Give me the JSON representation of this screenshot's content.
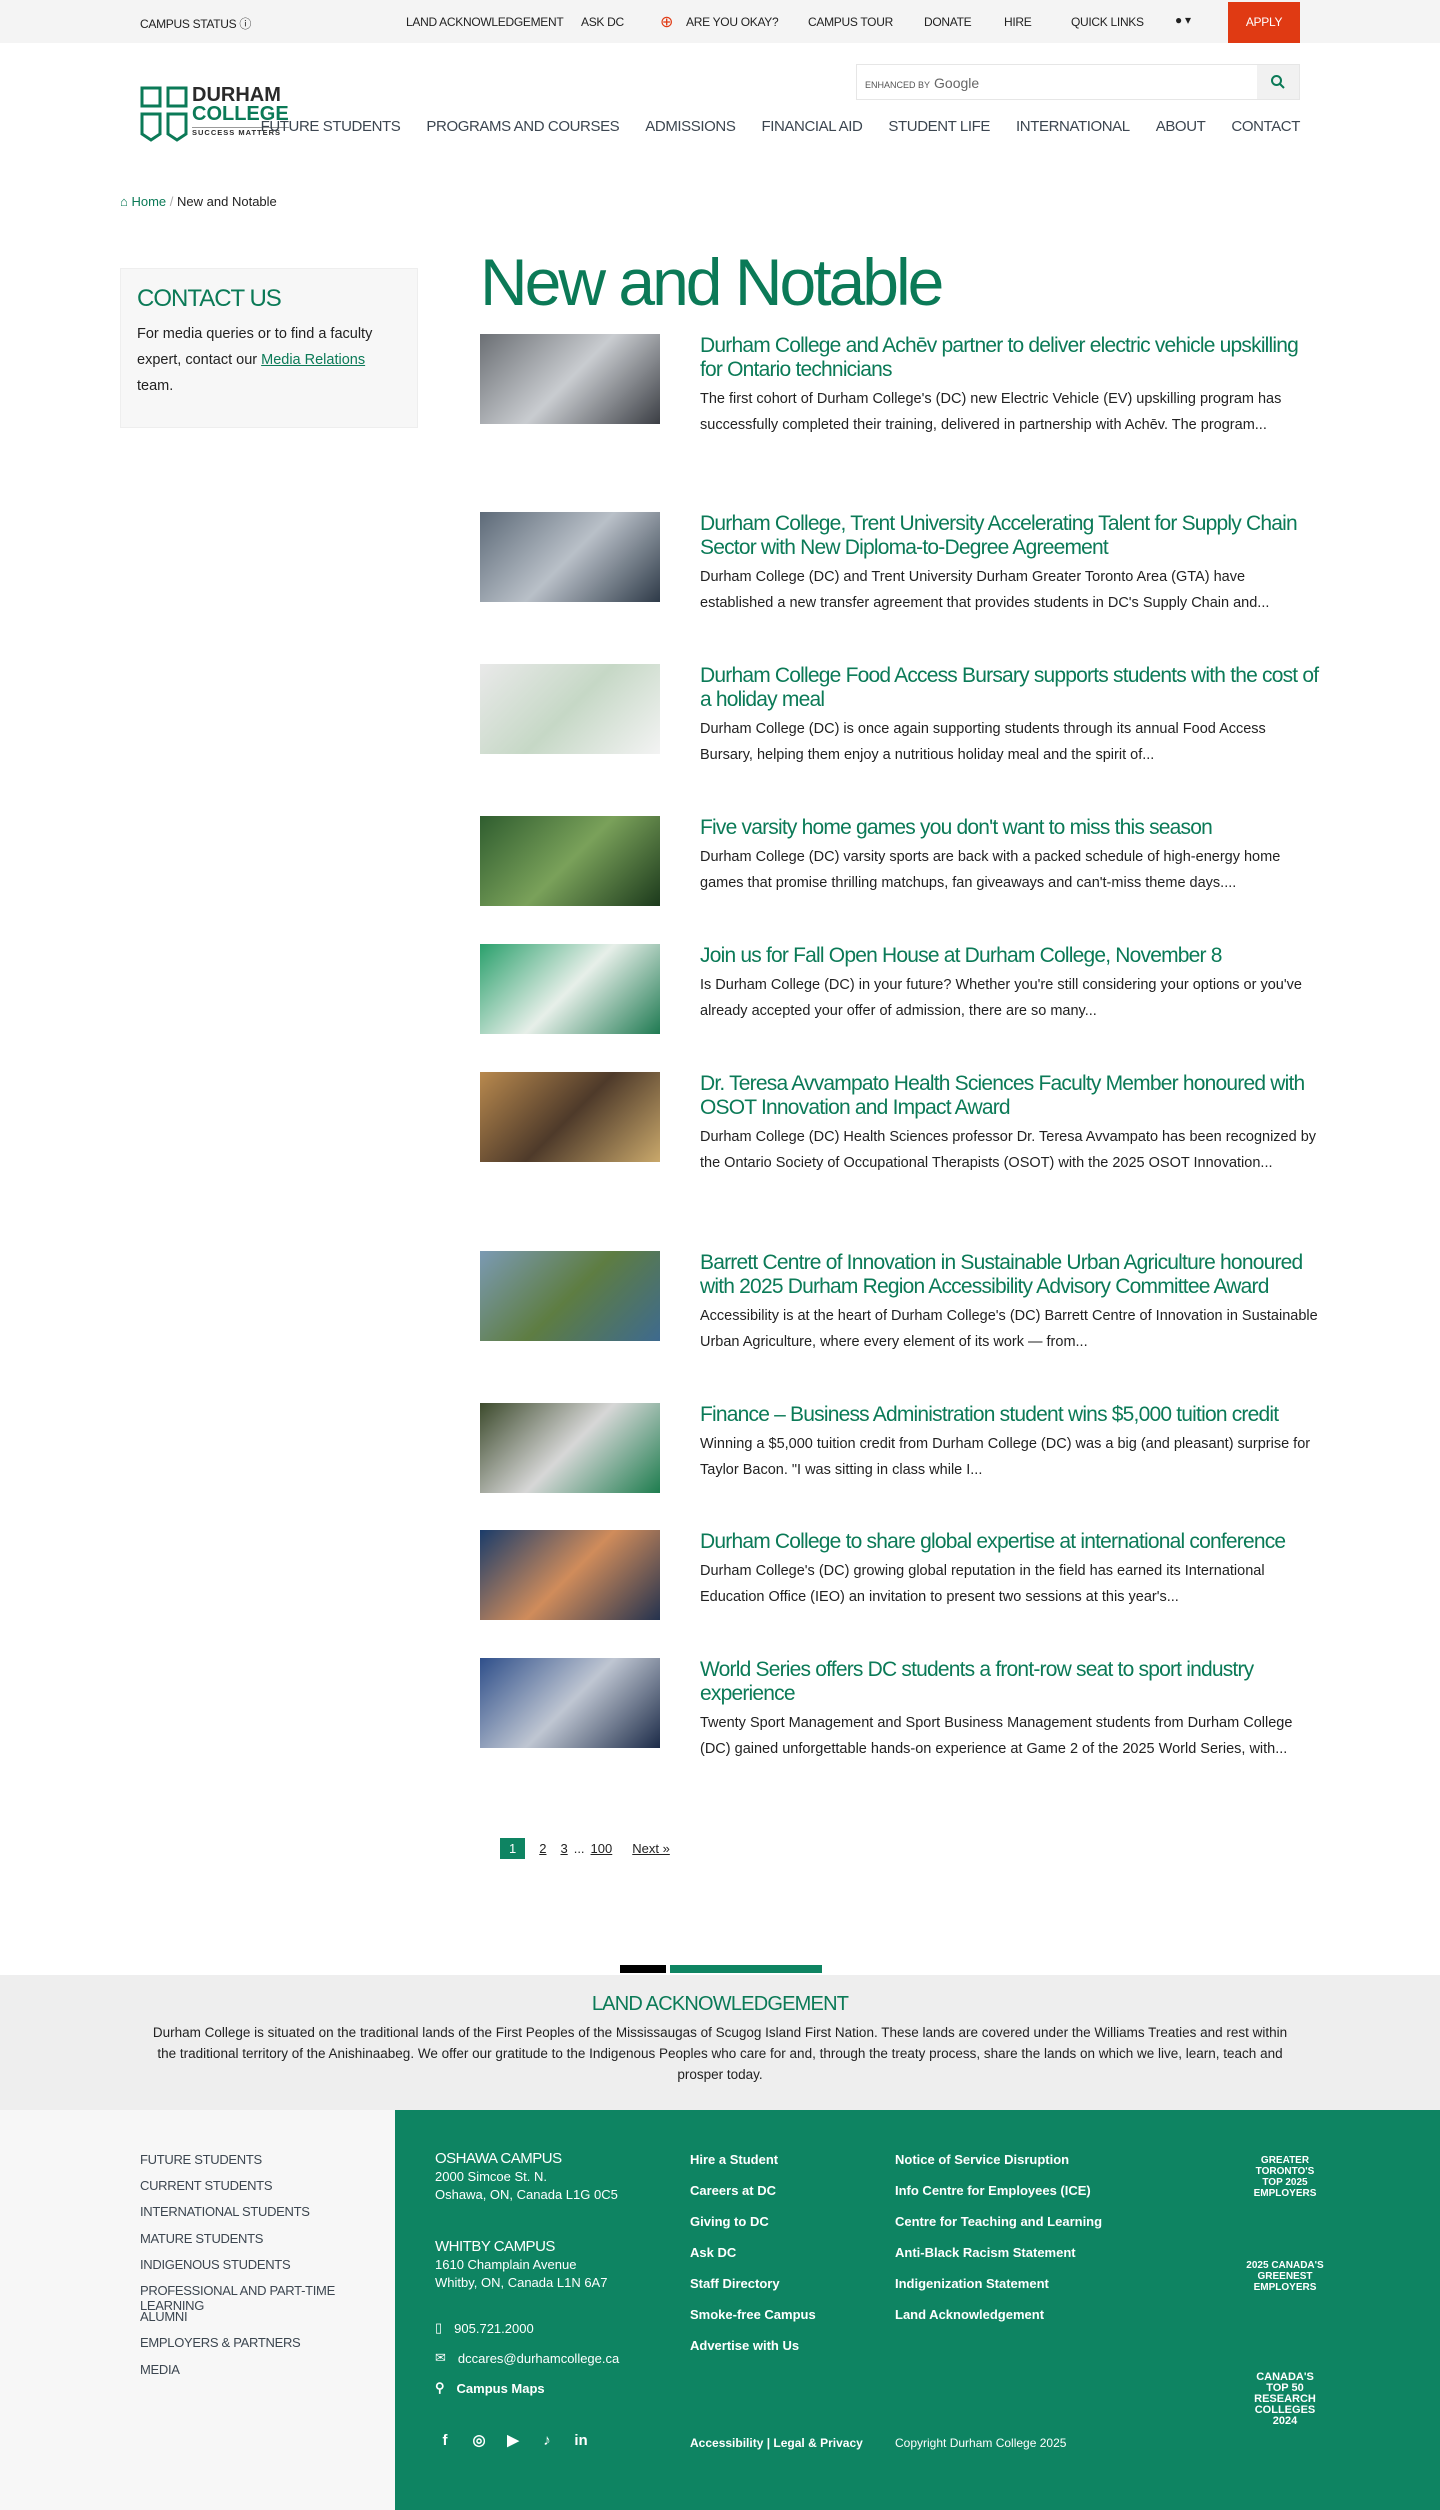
{
  "topbar": {
    "campus_status": "CAMPUS STATUS",
    "items": [
      "LAND ACKNOWLEDGEMENT",
      "ASK DC",
      "ARE YOU OKAY?",
      "CAMPUS TOUR",
      "DONATE",
      "HIRE",
      "QUICK LINKS"
    ],
    "apply": "APPLY"
  },
  "logo": {
    "line1": "DURHAM",
    "line2": "COLLEGE",
    "tagline": "SUCCESS MATTERS"
  },
  "search": {
    "enhanced": "ENHANCED BY",
    "google": "Google"
  },
  "nav": [
    "FUTURE STUDENTS",
    "PROGRAMS AND COURSES",
    "ADMISSIONS",
    "FINANCIAL AID",
    "STUDENT LIFE",
    "INTERNATIONAL",
    "ABOUT",
    "CONTACT"
  ],
  "breadcrumb": {
    "home": "Home",
    "current": "New and Notable"
  },
  "sidebar": {
    "title": "CONTACT US",
    "text_before": "For media queries or to find a faculty expert, contact our ",
    "link": "Media Relations",
    "text_after": " team."
  },
  "page_title": "New and Notable",
  "articles": [
    {
      "title": "Durham College and Achēv partner to deliver electric vehicle upskilling for Ontario technicians",
      "excerpt": "The first cohort of Durham College's (DC) new Electric Vehicle (EV) upskilling program has successfully completed their training, delivered in partnership with Achēv. The program..."
    },
    {
      "title": "Durham College, Trent University Accelerating Talent for Supply Chain Sector with New Diploma-to-Degree Agreement",
      "excerpt": "Durham College (DC) and Trent University Durham Greater Toronto Area (GTA) have established a new transfer agreement that provides students in DC's Supply Chain and..."
    },
    {
      "title": "Durham College Food Access Bursary supports students with the cost of a holiday meal",
      "excerpt": "Durham College (DC) is once again supporting students through its annual Food Access Bursary, helping them enjoy a nutritious holiday meal and the spirit of..."
    },
    {
      "title": "Five varsity home games you don't want to miss this season",
      "excerpt": "Durham College (DC) varsity sports are back with a packed schedule of high-energy home games that promise thrilling matchups, fan giveaways and can't-miss theme days...."
    },
    {
      "title": "Join us for Fall Open House at Durham College, November 8",
      "excerpt": "Is Durham College (DC) in your future? Whether you're still considering your options or you've already accepted your offer of admission, there are so many..."
    },
    {
      "title": "Dr. Teresa Avvampato Health Sciences Faculty Member honoured with OSOT Innovation and Impact Award",
      "excerpt": "Durham College (DC) Health Sciences professor Dr. Teresa Avvampato has been recognized by the Ontario Society of Occupational Therapists (OSOT) with the 2025 OSOT Innovation..."
    },
    {
      "title": "Barrett Centre of Innovation in Sustainable Urban Agriculture honoured with 2025 Durham Region Accessibility Advisory Committee Award",
      "excerpt": "Accessibility is at the heart of Durham College's (DC) Barrett Centre of Innovation in Sustainable Urban Agriculture, where every element of its work — from..."
    },
    {
      "title": "Finance – Business Administration student wins $5,000 tuition credit",
      "excerpt": "Winning a $5,000 tuition credit from Durham College (DC) was a big (and pleasant) surprise for Taylor Bacon. \"I was sitting in class while I..."
    },
    {
      "title": "Durham College to share global expertise at international conference",
      "excerpt": "Durham College's (DC) growing global reputation in the field has earned its International Education Office (IEO) an invitation to present two sessions at this year's..."
    },
    {
      "title": "World Series offers DC students a front-row seat to sport industry experience",
      "excerpt": "Twenty Sport Management and Sport Business Management students from Durham College (DC) gained unforgettable hands-on experience at Game 2 of the 2025 World Series, with..."
    }
  ],
  "pagination": {
    "current": "1",
    "pages": [
      "2",
      "3"
    ],
    "ellipsis": "...",
    "last": "100",
    "next": "Next »"
  },
  "land_ack": {
    "title": "LAND ACKNOWLEDGEMENT",
    "text": "Durham College is situated on the traditional lands of the First Peoples of the Mississaugas of Scugog Island First Nation. These lands are covered under the Williams Treaties and rest within the traditional territory of the Anishinaabeg. We offer our gratitude to the Indigenous Peoples who care for and, through the treaty process, share the lands on which we live, learn, teach and prosper today."
  },
  "footer": {
    "left_links": [
      "FUTURE STUDENTS",
      "CURRENT STUDENTS",
      "INTERNATIONAL STUDENTS",
      "MATURE STUDENTS",
      "INDIGENOUS STUDENTS",
      "PROFESSIONAL AND PART-TIME LEARNING",
      "ALUMNI",
      "EMPLOYERS & PARTNERS",
      "MEDIA"
    ],
    "oshawa": {
      "name": "OSHAWA CAMPUS",
      "line1": "2000 Simcoe St. N.",
      "line2": "Oshawa, ON, Canada L1G 0C5"
    },
    "whitby": {
      "name": "WHITBY CAMPUS",
      "line1": "1610 Champlain Avenue",
      "line2": "Whitby, ON, Canada L1N 6A7"
    },
    "phone": "905.721.2000",
    "email": "dccares@durhamcollege.ca",
    "maps": "Campus Maps",
    "col1": [
      "Hire a Student",
      "Careers at DC",
      "Giving to DC",
      "Ask DC",
      "Staff Directory",
      "Smoke-free Campus",
      "Advertise with Us"
    ],
    "col2": [
      "Notice of Service Disruption",
      "Info Centre for Employees (ICE)",
      "Centre for Teaching and Learning",
      "Anti-Black Racism Statement",
      "Indigenization Statement",
      "Land Acknowledgement"
    ],
    "accessibility": "Accessibility",
    "legal": "Legal & Privacy",
    "copyright": "Copyright Durham College 2025",
    "badges": {
      "toronto": "GREATER TORONTO'S TOP 2025 EMPLOYERS",
      "greenest": "2025 CANADA'S GREENEST EMPLOYERS",
      "research": "CANADA'S TOP 50 RESEARCH COLLEGES 2024"
    }
  },
  "colors": {
    "brand_green": "#0b7a57",
    "footer_green": "#0e8462",
    "apply_red": "#e03a13"
  }
}
